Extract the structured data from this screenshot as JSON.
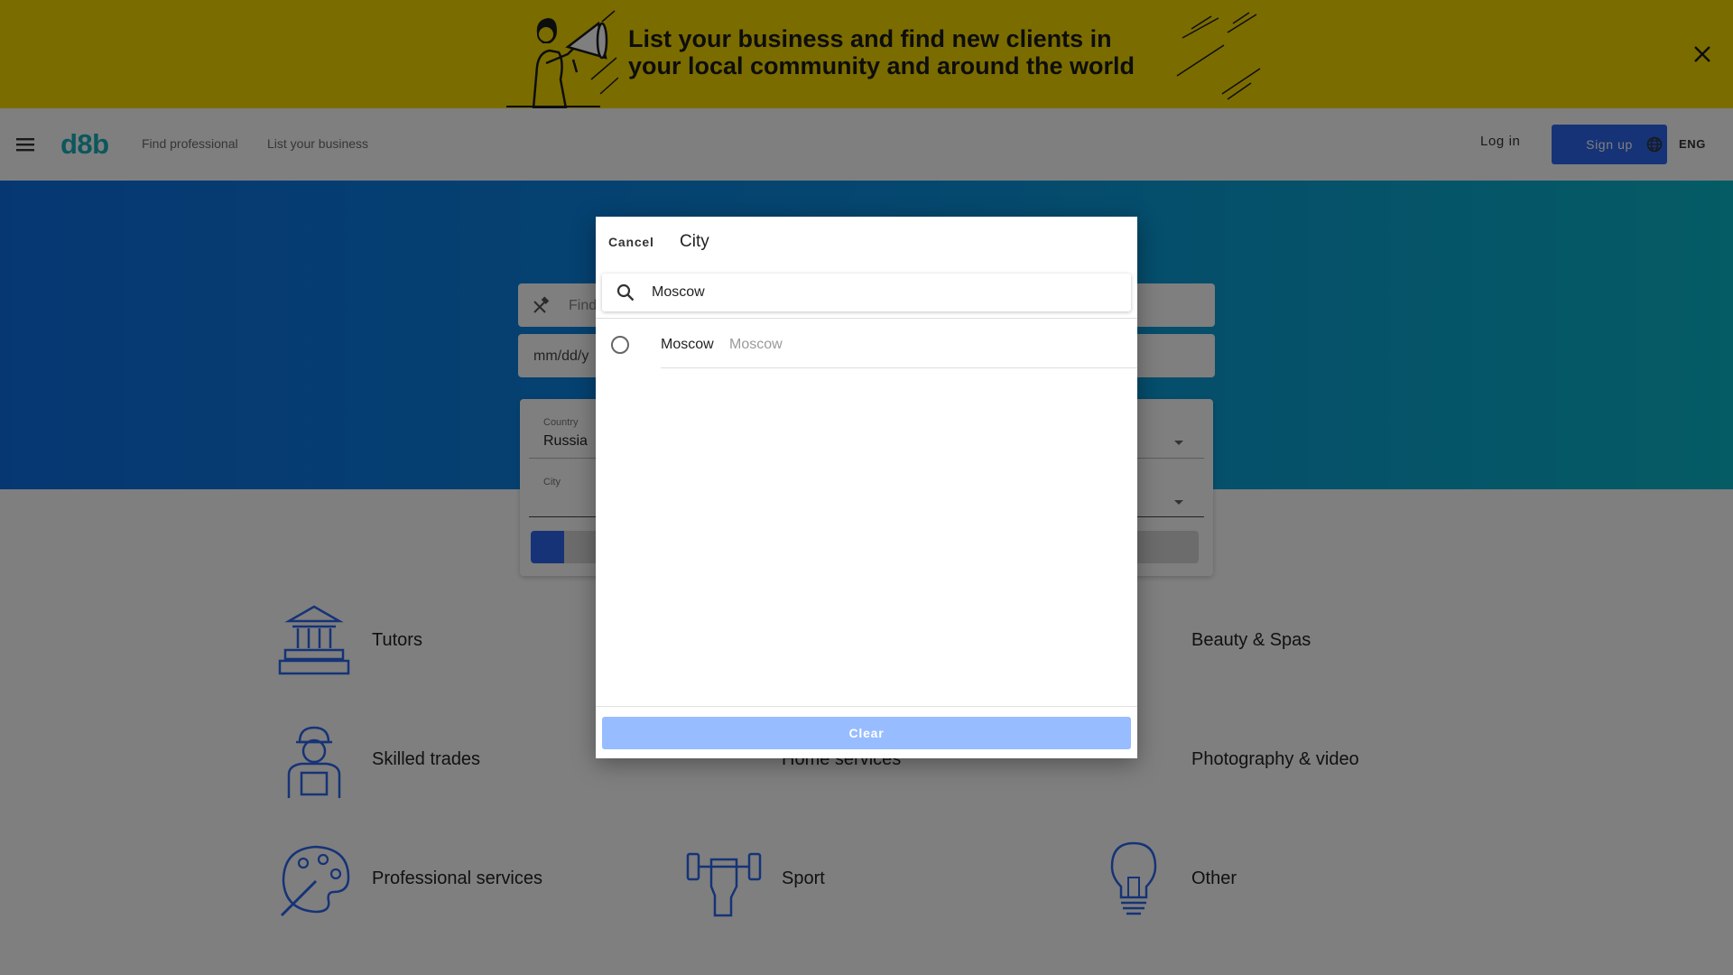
{
  "banner": {
    "text": "List your business and find new clients in your local community and around the world",
    "close_icon": "close-icon",
    "bg_color": "#f7d800"
  },
  "header": {
    "logo": "d8b",
    "nav": [
      "Find professional",
      "List your business"
    ],
    "login_label": "Log in",
    "signup_label": "Sign up",
    "language": "ENG",
    "logo_color": "#1aaeb8",
    "accent_color": "#2d67ee"
  },
  "hero": {
    "search_placeholder": "Find",
    "date_placeholder": "mm/dd/y",
    "country_label": "Country",
    "country_value": "Russia",
    "city_label": "City"
  },
  "categories": [
    {
      "label": "Tutors",
      "icon": "library-icon"
    },
    {
      "label": "Beauty & Spas",
      "icon": "scissors-icon"
    },
    {
      "label": "Skilled trades",
      "icon": "worker-icon"
    },
    {
      "label": "Home services",
      "icon": "door-icon"
    },
    {
      "label": "Photography & video",
      "icon": "aperture-icon"
    },
    {
      "label": "Professional services",
      "icon": "palette-icon"
    },
    {
      "label": "Sport",
      "icon": "dumbbell-icon"
    },
    {
      "label": "Other",
      "icon": "lightbulb-icon"
    }
  ],
  "modal": {
    "cancel_label": "Cancel",
    "title": "City",
    "search_value": "Moscow",
    "results": [
      {
        "name": "Moscow",
        "region": "Moscow"
      }
    ],
    "clear_label": "Clear"
  }
}
